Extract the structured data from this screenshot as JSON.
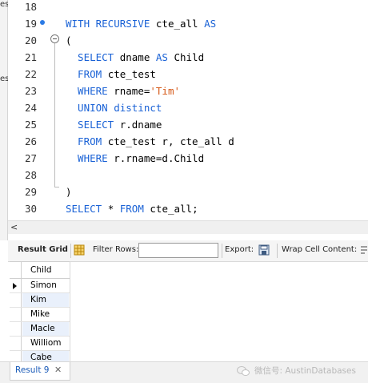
{
  "left_panel": {
    "fragment_top": "es",
    "fragment_mid": "es"
  },
  "editor": {
    "line_numbers": [
      "18",
      "19",
      "20",
      "21",
      "22",
      "23",
      "24",
      "25",
      "26",
      "27",
      "28",
      "29",
      "30"
    ],
    "lines": [
      {
        "n": "18",
        "parts": []
      },
      {
        "n": "19",
        "parts": [
          {
            "t": "WITH RECURSIVE ",
            "c": "kw"
          },
          {
            "t": "cte_all ",
            "c": ""
          },
          {
            "t": "AS",
            "c": "kw"
          }
        ]
      },
      {
        "n": "20",
        "parts": [
          {
            "t": "(",
            "c": ""
          }
        ]
      },
      {
        "n": "21",
        "parts": [
          {
            "t": "  SELECT ",
            "c": "kw"
          },
          {
            "t": "dname ",
            "c": ""
          },
          {
            "t": "AS ",
            "c": "kw"
          },
          {
            "t": "Child",
            "c": ""
          }
        ]
      },
      {
        "n": "22",
        "parts": [
          {
            "t": "  FROM ",
            "c": "kw"
          },
          {
            "t": "cte_test",
            "c": ""
          }
        ]
      },
      {
        "n": "23",
        "parts": [
          {
            "t": "  WHERE ",
            "c": "kw"
          },
          {
            "t": "rname=",
            "c": ""
          },
          {
            "t": "'Tim'",
            "c": "str"
          }
        ]
      },
      {
        "n": "24",
        "parts": [
          {
            "t": "  UNION distinct",
            "c": "kw"
          }
        ]
      },
      {
        "n": "25",
        "parts": [
          {
            "t": "  SELECT ",
            "c": "kw"
          },
          {
            "t": "r.dname",
            "c": ""
          }
        ]
      },
      {
        "n": "26",
        "parts": [
          {
            "t": "  FROM ",
            "c": "kw"
          },
          {
            "t": "cte_test r, cte_all d",
            "c": ""
          }
        ]
      },
      {
        "n": "27",
        "parts": [
          {
            "t": "  WHERE ",
            "c": "kw"
          },
          {
            "t": "r.rname=d.Child",
            "c": ""
          }
        ]
      },
      {
        "n": "28",
        "parts": []
      },
      {
        "n": "29",
        "parts": [
          {
            "t": ")",
            "c": ""
          }
        ]
      },
      {
        "n": "30",
        "parts": [
          {
            "t": "SELECT ",
            "c": "kw"
          },
          {
            "t": "* ",
            "c": ""
          },
          {
            "t": "FROM ",
            "c": "kw"
          },
          {
            "t": "cte_all;",
            "c": ""
          }
        ]
      }
    ]
  },
  "toolbar": {
    "result_grid": "Result Grid",
    "filter_rows": "Filter Rows:",
    "filter_value": "",
    "export": "Export:",
    "wrap_cell": "Wrap Cell Content:"
  },
  "grid": {
    "column": "Child",
    "rows": [
      "Simon",
      "Kim",
      "Mike",
      "Macle",
      "Williom",
      "Cabe"
    ]
  },
  "tabs": {
    "result": "Result 9"
  },
  "watermark": "微信号: AustinDatabases",
  "colors": {
    "keyword": "#1a62d6",
    "string": "#d65a1a",
    "tab_text": "#1a5bb8"
  }
}
